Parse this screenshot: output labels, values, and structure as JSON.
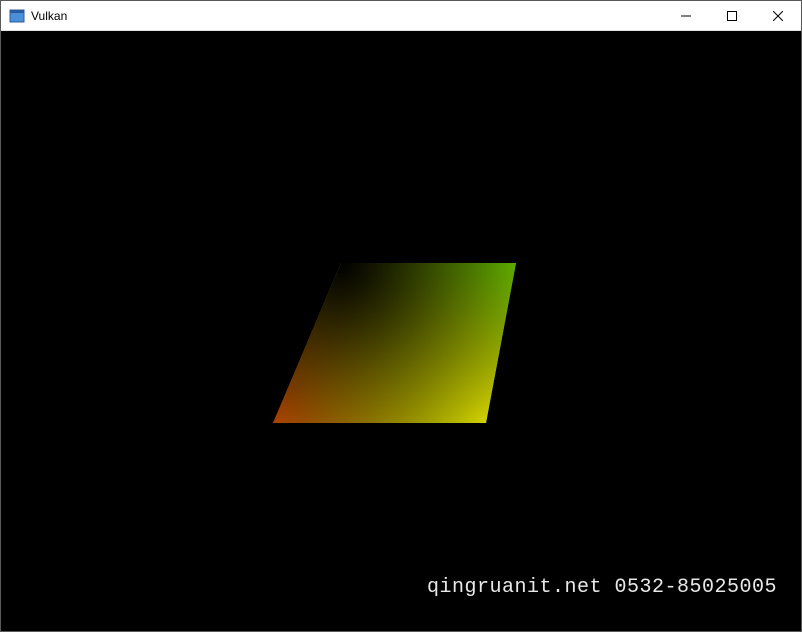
{
  "window": {
    "title": "Vulkan",
    "icon_name": "app-icon"
  },
  "controls": {
    "minimize_glyph": "—",
    "maximize_glyph": "☐",
    "close_glyph": "✕"
  },
  "render": {
    "background_color": "#000000",
    "quad": {
      "vertex_colors": {
        "top_left": "#000000",
        "top_right": "#00ff00",
        "bottom_right": "#ffff00",
        "bottom_left": "#ff0000"
      }
    }
  },
  "watermark": {
    "text": "qingruanit.net 0532-85025005"
  }
}
